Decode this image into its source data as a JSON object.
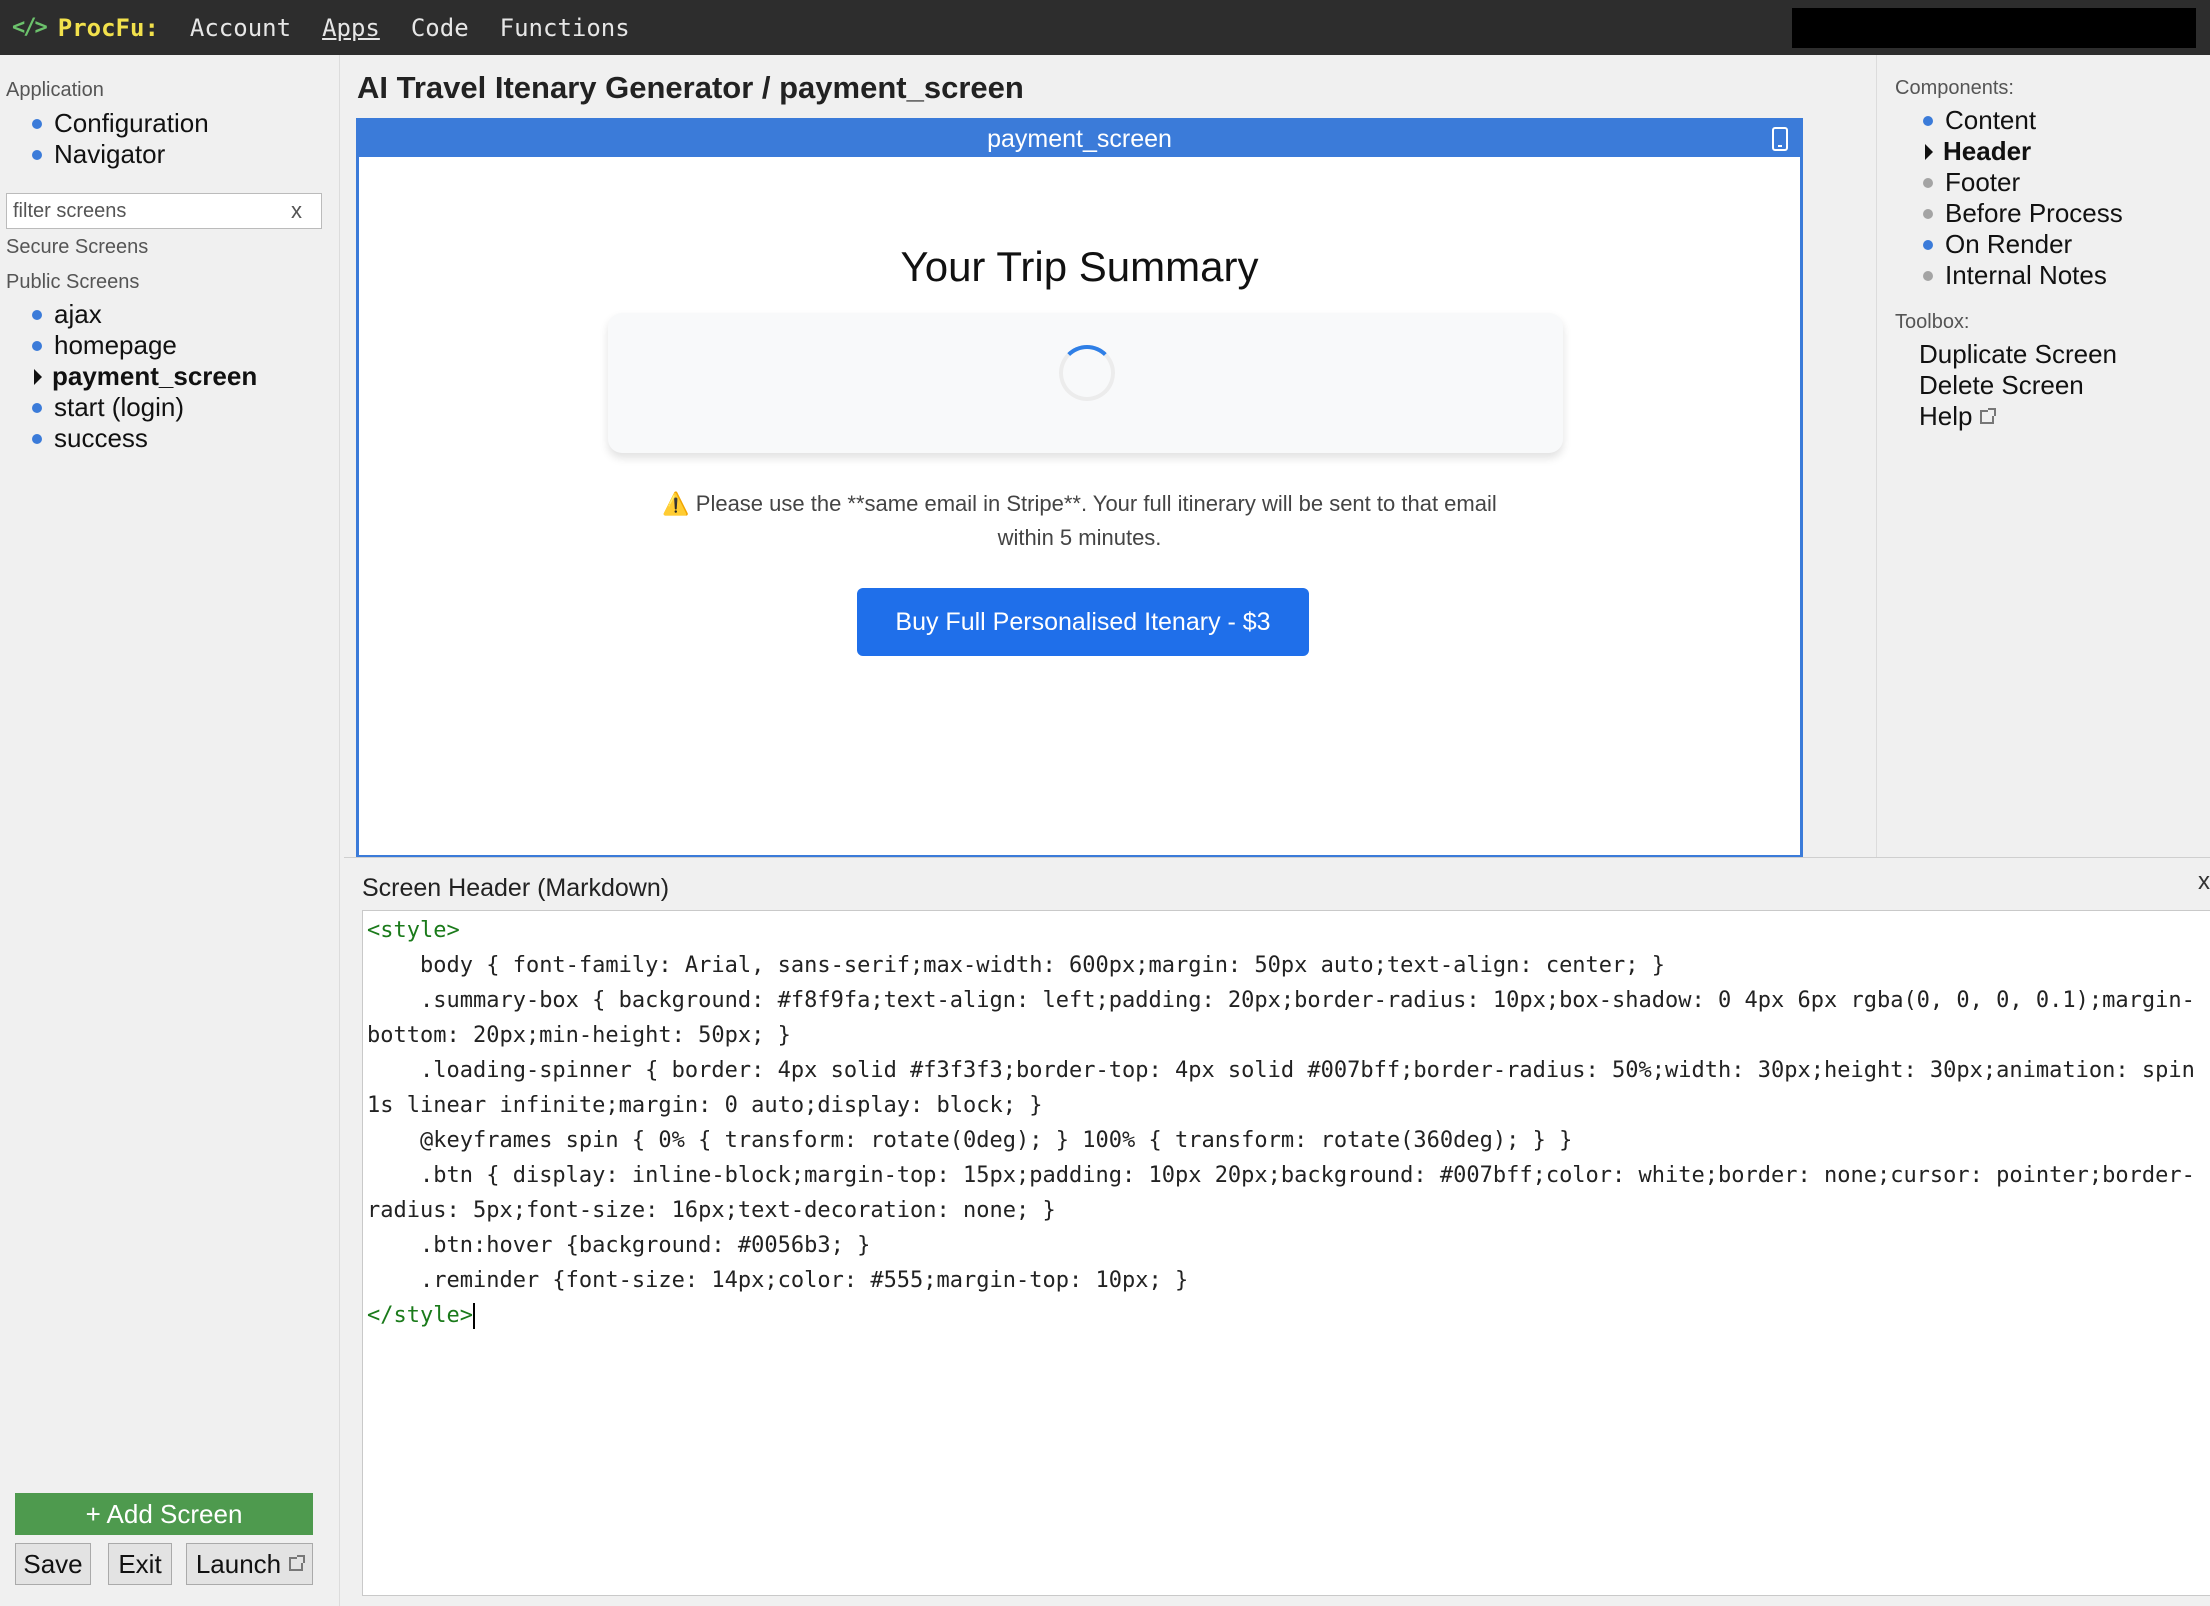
{
  "topbar": {
    "brand": "ProcFu:",
    "nav": [
      "Account",
      "Apps",
      "Code",
      "Functions"
    ]
  },
  "sidebar": {
    "application_label": "Application",
    "app_items": [
      "Configuration",
      "Navigator"
    ],
    "filter_placeholder": "filter screens",
    "filter_clear": "x",
    "secure_label": "Secure Screens",
    "public_label": "Public Screens",
    "screens": [
      "ajax",
      "homepage",
      "payment_screen",
      "start (login)",
      "success"
    ],
    "add_screen": "+ Add Screen",
    "save": "Save",
    "exit": "Exit",
    "launch": "Launch"
  },
  "main": {
    "title": "AI Travel Itenary Generator / payment_screen",
    "preview_title": "payment_screen",
    "trip_title": "Your Trip Summary",
    "reminder_icon": "⚠️",
    "reminder_line1": "Please use the **same email in Stripe**. Your full itinerary will be sent to that email",
    "reminder_line2": "within 5 minutes.",
    "buy_button": "Buy Full Personalised Itenary - $3"
  },
  "right": {
    "components_label": "Components:",
    "components": [
      "Content",
      "Header",
      "Footer",
      "Before Process",
      "On Render",
      "Internal Notes"
    ],
    "toolbox_label": "Toolbox:",
    "tools": [
      "Duplicate Screen",
      "Delete Screen",
      "Help"
    ]
  },
  "editor": {
    "title": "Screen Header (Markdown)",
    "close": "x",
    "open_tag": "<style>",
    "close_tag": "</style>",
    "lines": [
      "    body { font-family: Arial, sans-serif;max-width: 600px;margin: 50px auto;text-align: center; }",
      "    .summary-box { background: #f8f9fa;text-align: left;padding: 20px;border-radius: 10px;box-shadow: 0 4px 6px rgba(0, 0, 0, 0.1);margin-bottom: 20px;min-height: 50px; }",
      "    .loading-spinner { border: 4px solid #f3f3f3;border-top: 4px solid #007bff;border-radius: 50%;width: 30px;height: 30px;animation: spin 1s linear infinite;margin: 0 auto;display: block; }",
      "    @keyframes spin { 0% { transform: rotate(0deg); } 100% { transform: rotate(360deg); } }",
      "    .btn { display: inline-block;margin-top: 15px;padding: 10px 20px;background: #007bff;color: white;border: none;cursor: pointer;border-radius: 5px;font-size: 16px;text-decoration: none; }",
      "    .btn:hover {background: #0056b3; }",
      "    .reminder {font-size: 14px;color: #555;margin-top: 10px; }"
    ]
  }
}
